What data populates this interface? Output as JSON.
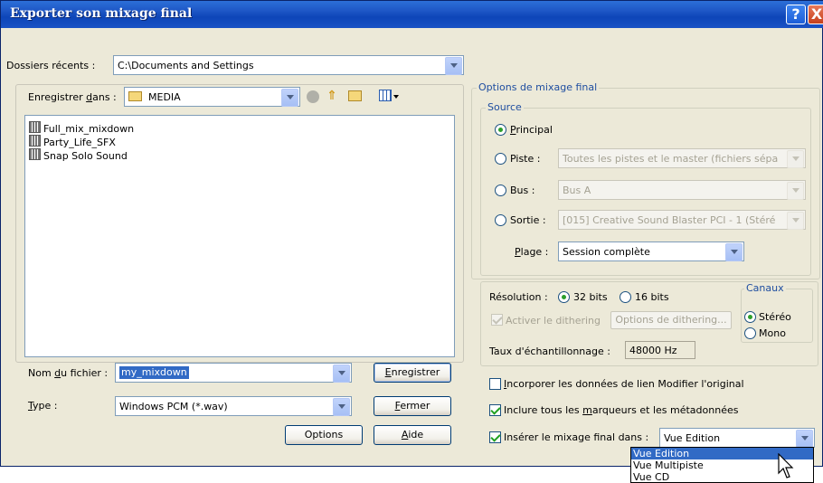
{
  "window": {
    "title": "Exporter son mixage final"
  },
  "titlebar": {
    "help": "?",
    "close": "X"
  },
  "recent": {
    "label": "Dossiers récents :",
    "value": "C:\\Documents and Settings"
  },
  "save_in": {
    "label_pre": "Enregistrer ",
    "label_u": "d",
    "label_post": "ans :",
    "folder": "MEDIA"
  },
  "files": [
    {
      "name": "Full_mix_mixdown"
    },
    {
      "name": "Party_Life_SFX"
    },
    {
      "name": "Snap Solo Sound"
    }
  ],
  "filename": {
    "label_pre": "Nom ",
    "label_u": "d",
    "label_post": "u fichier :",
    "value": "my_mixdown"
  },
  "filetype": {
    "label_u": "T",
    "label_post": "ype :",
    "value": "Windows PCM (*.wav)"
  },
  "buttons": {
    "save_u": "E",
    "save_post": "nregistrer",
    "close_u": "F",
    "close_post": "ermer",
    "options": "Options",
    "help_u": "A",
    "help_post": "ide"
  },
  "options_group": {
    "title": "Options de mixage final"
  },
  "source": {
    "title": "Source",
    "principal_u": "P",
    "principal_post": "rincipal",
    "piste_label": "Piste :",
    "piste_value": "Toutes les pistes et le master (fichiers sépa",
    "bus_label": "Bus :",
    "bus_value": "Bus A",
    "sortie_label": "Sortie :",
    "sortie_value": "[015] Creative Sound Blaster PCI - 1 (Stéré",
    "plage_u": "P",
    "plage_post": "lage :",
    "plage_value": "Session complète"
  },
  "format": {
    "resolution_label": "Résolution :",
    "bits32": "32 bits",
    "bits16": "16 bits",
    "dither_label": "Activer le dithering",
    "dither_options": "Options de dithering...",
    "rate_label": "Taux d'échantillonnage :",
    "rate_value": "48000 Hz",
    "channels_title": "Canaux",
    "stereo": "Stéréo",
    "mono": "Mono"
  },
  "checks": {
    "embed_u": "I",
    "embed_post": "ncorporer les données de lien Modifier l'original",
    "markers_pre": "Inclure tous les ",
    "markers_u": "m",
    "markers_post": "arqueurs et les métadonnées",
    "insert_label": "Insérer le mixage final dans :",
    "insert_value": "Vue Edition"
  },
  "dropdown": {
    "items": [
      "Vue Edition",
      "Vue Multipiste",
      "Vue CD"
    ],
    "selected_index": 0
  }
}
